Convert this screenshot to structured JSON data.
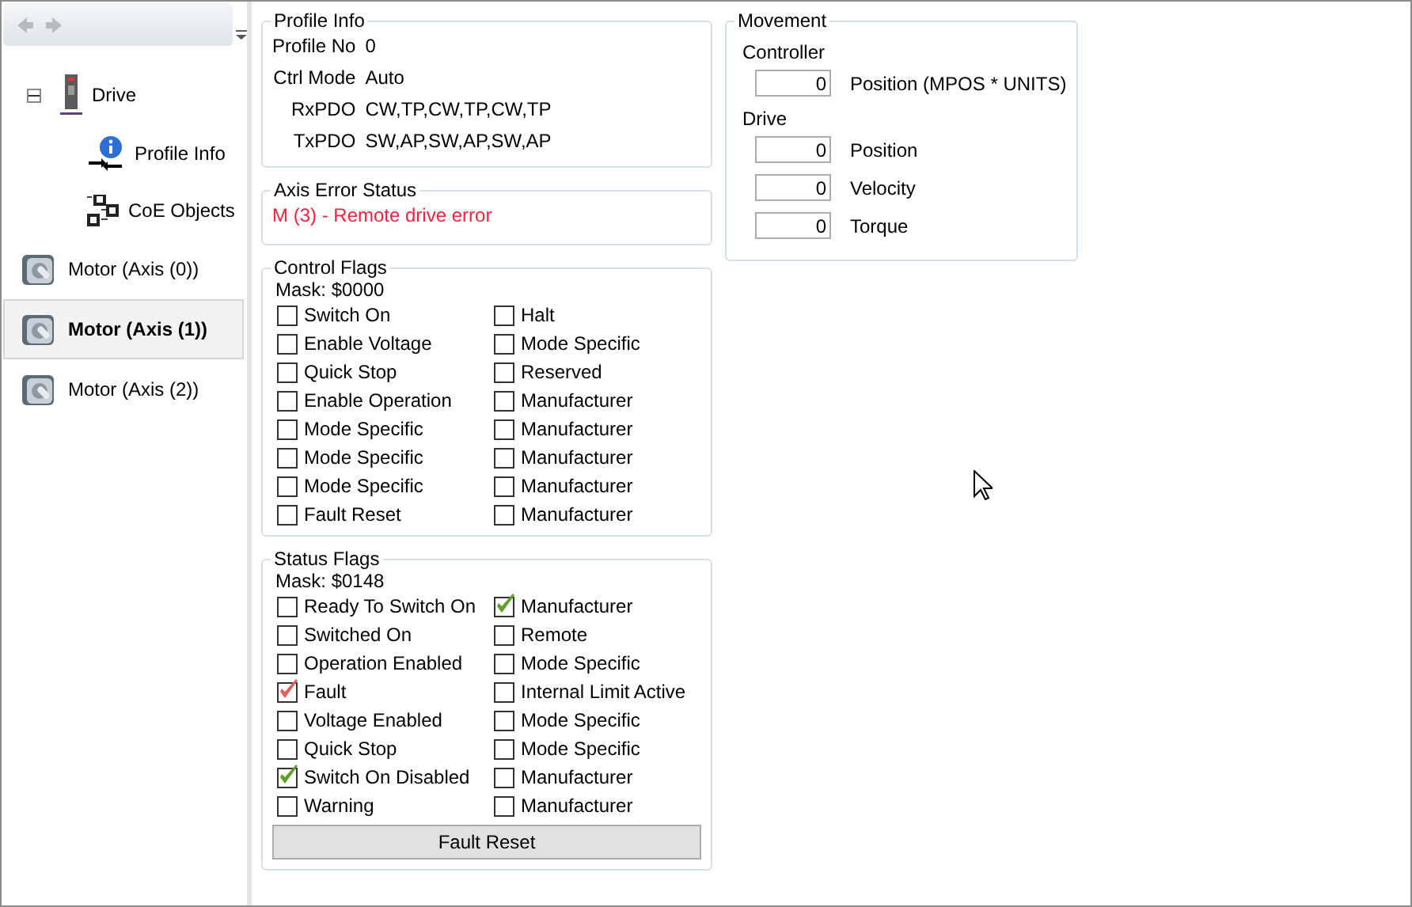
{
  "sidebar": {
    "toolbar": {
      "back_disabled": true,
      "forward_disabled": true
    },
    "tree": [
      {
        "label": "Drive",
        "kind": "drive",
        "expanded": true,
        "selected": false,
        "children": [
          {
            "label": "Profile Info",
            "kind": "info",
            "selected": false
          },
          {
            "label": "CoE Objects",
            "kind": "objects",
            "selected": false
          }
        ]
      },
      {
        "label": "Motor (Axis (0))",
        "kind": "motor",
        "selected": false
      },
      {
        "label": "Motor (Axis (1))",
        "kind": "motor",
        "selected": true
      },
      {
        "label": "Motor (Axis (2))",
        "kind": "motor",
        "selected": false
      }
    ]
  },
  "profile_info": {
    "title": "Profile Info",
    "rows": [
      {
        "label": "Profile No",
        "value": "0"
      },
      {
        "label": "Ctrl Mode",
        "value": "Auto"
      },
      {
        "label": "RxPDO",
        "value": "CW,TP,CW,TP,CW,TP"
      },
      {
        "label": "TxPDO",
        "value": "SW,AP,SW,AP,SW,AP"
      }
    ]
  },
  "axis_error": {
    "title": "Axis Error Status",
    "message": "M (3) - Remote drive error"
  },
  "control_flags": {
    "title": "Control Flags",
    "mask": "Mask: $0000",
    "flags": [
      {
        "label": "Switch On",
        "checked": false
      },
      {
        "label": "Halt",
        "checked": false
      },
      {
        "label": "Enable Voltage",
        "checked": false
      },
      {
        "label": "Mode Specific",
        "checked": false
      },
      {
        "label": "Quick Stop",
        "checked": false
      },
      {
        "label": "Reserved",
        "checked": false
      },
      {
        "label": "Enable Operation",
        "checked": false
      },
      {
        "label": "Manufacturer",
        "checked": false
      },
      {
        "label": "Mode Specific",
        "checked": false
      },
      {
        "label": "Manufacturer",
        "checked": false
      },
      {
        "label": "Mode Specific",
        "checked": false
      },
      {
        "label": "Manufacturer",
        "checked": false
      },
      {
        "label": "Mode Specific",
        "checked": false
      },
      {
        "label": "Manufacturer",
        "checked": false
      },
      {
        "label": "Fault Reset",
        "checked": false
      },
      {
        "label": "Manufacturer",
        "checked": false
      }
    ]
  },
  "status_flags": {
    "title": "Status Flags",
    "mask": "Mask: $0148",
    "flags": [
      {
        "label": "Ready To Switch On",
        "checked": false
      },
      {
        "label": "Manufacturer",
        "checked": true,
        "color": "#5aa02c"
      },
      {
        "label": "Switched On",
        "checked": false
      },
      {
        "label": "Remote",
        "checked": false
      },
      {
        "label": "Operation Enabled",
        "checked": false
      },
      {
        "label": "Mode Specific",
        "checked": false
      },
      {
        "label": "Fault",
        "checked": true,
        "color": "#e06060"
      },
      {
        "label": "Internal Limit Active",
        "checked": false
      },
      {
        "label": "Voltage Enabled",
        "checked": false
      },
      {
        "label": "Mode Specific",
        "checked": false
      },
      {
        "label": "Quick Stop",
        "checked": false
      },
      {
        "label": "Mode Specific",
        "checked": false
      },
      {
        "label": "Switch On Disabled",
        "checked": true,
        "color": "#5aa02c"
      },
      {
        "label": "Manufacturer",
        "checked": false
      },
      {
        "label": "Warning",
        "checked": false
      },
      {
        "label": "Manufacturer",
        "checked": false
      }
    ],
    "button": "Fault Reset"
  },
  "movement": {
    "title": "Movement",
    "sections": [
      {
        "title": "Controller",
        "rows": [
          {
            "value": "0",
            "label": "Position (MPOS * UNITS)"
          }
        ]
      },
      {
        "title": "Drive",
        "rows": [
          {
            "value": "0",
            "label": "Position"
          },
          {
            "value": "0",
            "label": "Velocity"
          },
          {
            "value": "0",
            "label": "Torque"
          }
        ]
      }
    ]
  }
}
